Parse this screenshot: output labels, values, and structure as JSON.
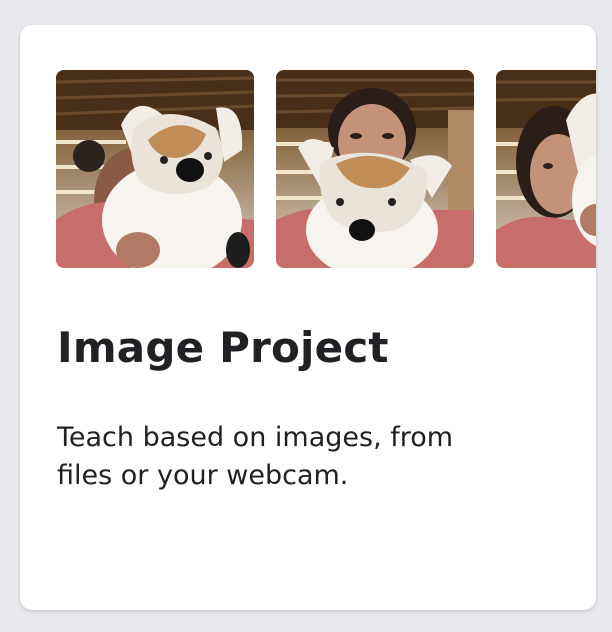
{
  "card": {
    "title": "Image Project",
    "description": "Teach based on images, from files or your webcam."
  },
  "colors": {
    "page_background": "#e9eaee",
    "card_background": "#ffffff",
    "text": "#202124"
  },
  "thumbnails": [
    {
      "icon": "webcam-sample-photo-person-with-plush-corgi"
    },
    {
      "icon": "webcam-sample-photo-person-with-plush-corgi"
    },
    {
      "icon": "webcam-sample-photo-person-with-plush-corgi"
    }
  ]
}
